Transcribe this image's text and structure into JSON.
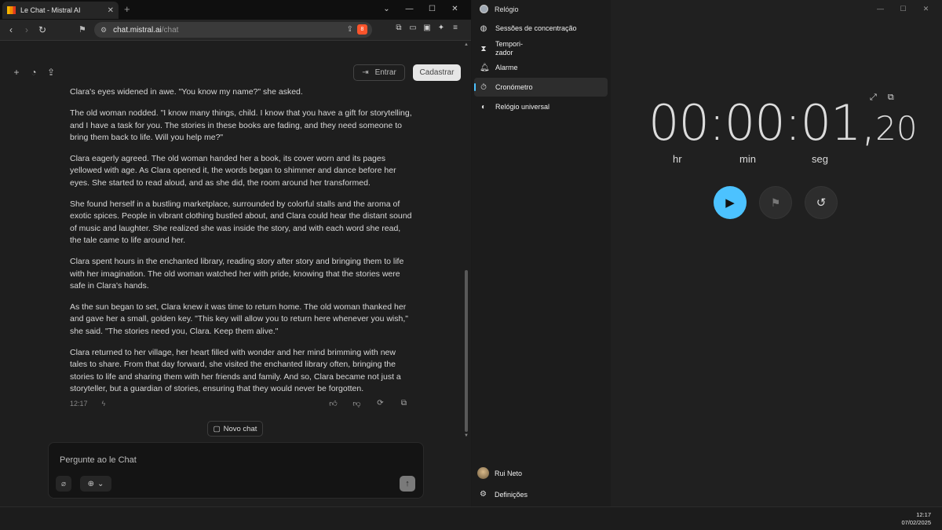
{
  "browser": {
    "tab_title": "Le Chat - Mistral AI",
    "url_domain": "chat.mistral.ai",
    "url_path": "/chat",
    "brave_badge": "8"
  },
  "chat": {
    "login_label": "Entrar",
    "signup_label": "Cadastrar",
    "paragraphs": [
      "Clara's eyes widened in awe. \"You know my name?\" she asked.",
      "The old woman nodded. \"I know many things, child. I know that you have a gift for storytelling, and I have a task for you. The stories in these books are fading, and they need someone to bring them back to life. Will you help me?\"",
      "Clara eagerly agreed. The old woman handed her a book, its cover worn and its pages yellowed with age. As Clara opened it, the words began to shimmer and dance before her eyes. She started to read aloud, and as she did, the room around her transformed.",
      "She found herself in a bustling marketplace, surrounded by colorful stalls and the aroma of exotic spices. People in vibrant clothing bustled about, and Clara could hear the distant sound of music and laughter. She realized she was inside the story, and with each word she read, the tale came to life around her.",
      "Clara spent hours in the enchanted library, reading story after story and bringing them to life with her imagination. The old woman watched her with pride, knowing that the stories were safe in Clara's hands.",
      "As the sun began to set, Clara knew it was time to return home. The old woman thanked her and gave her a small, golden key. \"This key will allow you to return here whenever you wish,\" she said. \"The stories need you, Clara. Keep them alive.\"",
      "Clara returned to her village, her heart filled with wonder and her mind brimming with new tales to share. From that day forward, she visited the enchanted library often, bringing the stories to life and sharing them with her friends and family. And so, Clara became not just a storyteller, but a guardian of stories, ensuring that they would never be forgotten."
    ],
    "message_time": "12:17",
    "new_chat_label": "Novo chat",
    "input_placeholder": "Pergunte ao le Chat"
  },
  "clock": {
    "app_title": "Relógio",
    "nav": {
      "focus": "Sessões de concentração",
      "timer_line1": "Tempori-",
      "timer_line2": "zador",
      "alarm": "Alarme",
      "stopwatch": "Cronómetro",
      "world": "Relógio universal"
    },
    "user_name": "Rui Neto",
    "settings_label": "Definições",
    "stopwatch_main": "00:00:01,",
    "stopwatch_fraction": "20",
    "unit_hr": "hr",
    "unit_min": "min",
    "unit_seg": "seg",
    "accent_color": "#4cc2ff"
  },
  "taskbar": {
    "time": "12:17",
    "date": "07/02/2025"
  }
}
